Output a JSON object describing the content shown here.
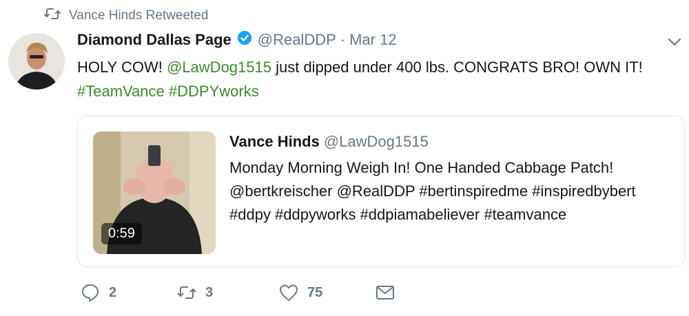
{
  "retweet_context": {
    "text": "Vance Hinds Retweeted",
    "icon": "retweet-icon"
  },
  "tweet": {
    "display_name": "Diamond Dallas Page",
    "verified": true,
    "handle": "@RealDDP",
    "separator": "·",
    "date": "Mar 12",
    "text_parts": {
      "p1": "HOLY COW! ",
      "mention": "@LawDog1515",
      "p2": " just dipped under 400 lbs. CONGRATS BRO! OWN IT! ",
      "hashtag1": "#TeamVance",
      "space": " ",
      "hashtag2": "#DDPYworks"
    }
  },
  "quoted": {
    "display_name": "Vance Hinds",
    "handle": "@LawDog1515",
    "text": "Monday Morning Weigh In!  One Handed Cabbage Patch! @bertkreischer @RealDDP #bertinspiredme #inspiredbybert #ddpy #ddpyworks #ddpiamabeliever #teamvance",
    "video_duration": "0:59"
  },
  "actions": {
    "reply_count": "2",
    "retweet_count": "3",
    "like_count": "75"
  },
  "colors": {
    "link": "#3b8a2a",
    "secondary": "#657786",
    "verified": "#1da1f2"
  }
}
